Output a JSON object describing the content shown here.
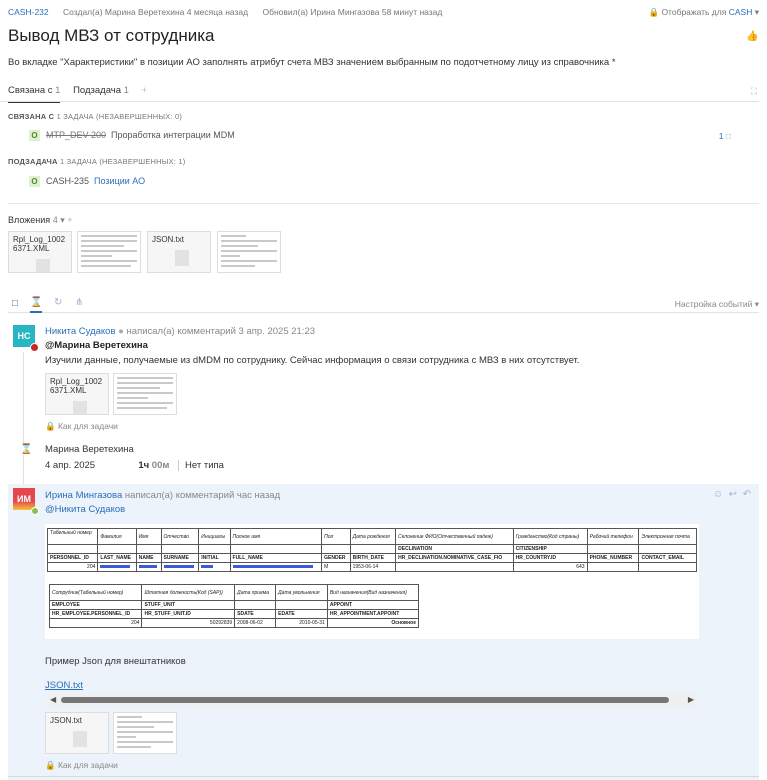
{
  "header": {
    "issue_key": "CASH-232",
    "created": "Создал(а) Марина Веретехина 4 месяца назад",
    "updated": "Обновил(а) Ирина Мингазова 58 минут назад",
    "visibility_label": "Отображать для",
    "visibility_value": "CASH",
    "title": "Вывод МВЗ от сотрудника",
    "description": "Во вкладке \"Характеристики\" в позиции АО заполнять атрибут счета МВЗ значением выбранным по подотчетному лицу из справочника *"
  },
  "tabs": [
    {
      "label": "Связана с",
      "count": "1"
    },
    {
      "label": "Подзадача",
      "count": "1"
    }
  ],
  "linked": {
    "header": "СВЯЗАНА С",
    "header_detail": "1 ЗАДАЧА (НЕЗАВЕРШЕННЫХ: 0)",
    "item": {
      "status": "O",
      "key": "MTP_DEV-200",
      "title": "Проработка интеграции MDM",
      "comments": "1"
    }
  },
  "subtask": {
    "header": "ПОДЗАДАЧА",
    "header_detail": "1 ЗАДАЧА (НЕЗАВЕРШЕННЫХ: 1)",
    "item": {
      "status": "O",
      "key": "CASH-235",
      "title": "Позиции АО"
    }
  },
  "attachments": {
    "label": "Вложения",
    "count": "4",
    "files": [
      "Rpl_Log_1002 6371.XML",
      "JSON.txt"
    ]
  },
  "activity": {
    "settings": "Настройка событий"
  },
  "comment1": {
    "initials": "НС",
    "author": "Никита Судаков",
    "action": "написал(а) комментарий 3 апр. 2025 21:23",
    "mention": "@Марина Веретехина",
    "text": "Изучили данные, получаемые из dMDM по сотруднику. Сейчас информация о связи сотрудника с МВЗ в них отсутствует.",
    "file": "Rpl_Log_1002 6371.XML",
    "access": "Как для задачи"
  },
  "worklog": {
    "author": "Марина Веретехина",
    "date": "4 апр. 2025",
    "hours": "1ч",
    "minutes": "00м",
    "type": "Нет типа"
  },
  "comment2": {
    "initials": "ИМ",
    "author": "Ирина Мингазова",
    "action": "написал(а) комментарий час назад",
    "mention": "@Никита Судаков",
    "text": "Пример Json для внештатников",
    "link": "JSON.txt",
    "file": "JSON.txt",
    "access": "Как для задачи"
  },
  "table1": {
    "ru": [
      "Табельный номер",
      "Фамилия",
      "Имя",
      "Отчество",
      "Инициалы",
      "Полное имя",
      "Пол",
      "Дата рождения",
      "Склонение ФИО(Отчественный падеж)",
      "Гражданство(Код страны)",
      "Рабочий телефон",
      "Электронная почта"
    ],
    "en": [
      "PERSONNEL_ID",
      "LAST_NAME",
      "NAME",
      "SURNAME",
      "INITIAL",
      "FULL_NAME",
      "GENDER",
      "BIRTH_DATE",
      "HR_DECLINATION.NOMINATIVE_CASE_FIO",
      "HR_COUNTRY.ID",
      "PHONE_NUMBER",
      "CONTACT_EMAIL"
    ],
    "group": [
      "DECLINATION",
      "CITIZENSHIP"
    ],
    "values": {
      "id": "204",
      "gender": "M",
      "birth": "1953-06-14",
      "country": "643"
    }
  },
  "table2": {
    "ru": [
      "Сотрудник(Табельный номер)",
      "Штатная должность(Код (SAP))",
      "Дата приема",
      "Дата увольнения",
      "Вид назначения(Вид назначения)"
    ],
    "group": [
      "EMPLOYEE",
      "STUFF_UNIT",
      "",
      "",
      "APPOINT"
    ],
    "en": [
      "HR_EMPLOYEE.PERSONNEL_ID",
      "HR_STUFF_UNIT.ID",
      "SDATE",
      "EDATE",
      "HR_APPOINTMENT.APPOINT"
    ],
    "values": [
      "204",
      "50292839",
      "2008-06-02",
      "2010-05-31",
      "Основное"
    ]
  }
}
